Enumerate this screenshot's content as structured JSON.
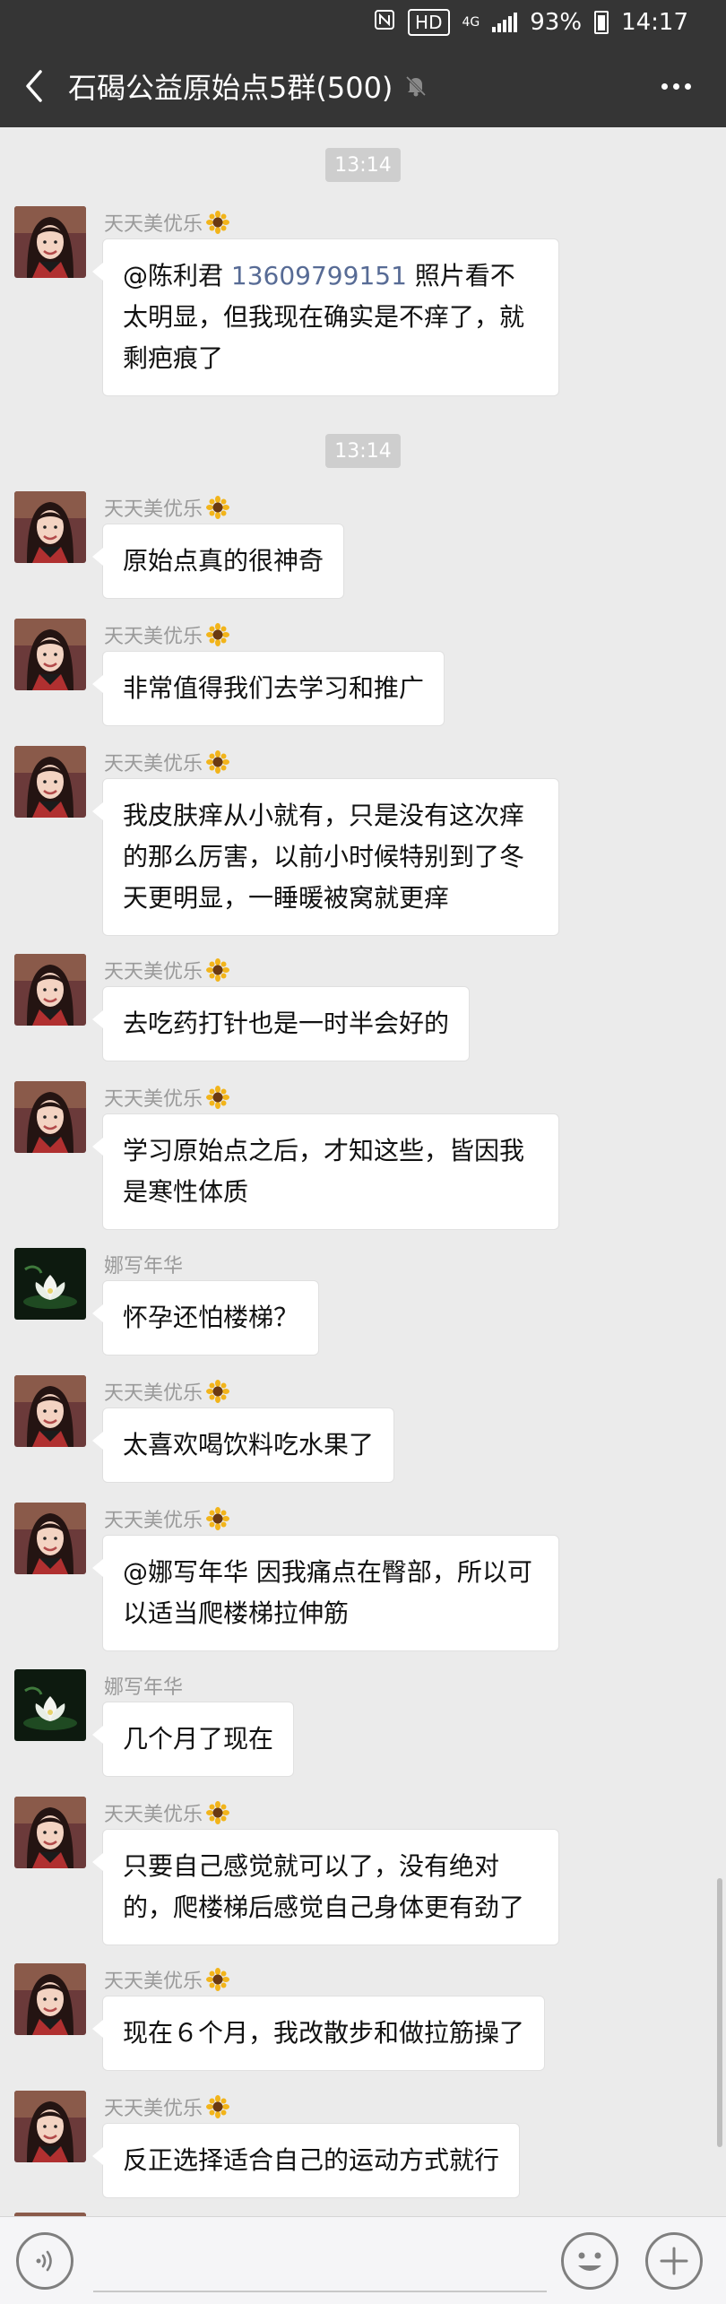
{
  "status_bar": {
    "network": "4G",
    "battery": "93%",
    "time": "14:17",
    "hd": "HD"
  },
  "header": {
    "title": "石碣公益原始点5群(500)"
  },
  "chat": {
    "times": [
      "13:14",
      "13:14"
    ],
    "messages": [
      {
        "sender": "天天美优乐",
        "mention": "@陈利君",
        "phone": "13609799151",
        "text": " 照片看不太明显，但我现在确实是不痒了，就剩疤痕了"
      },
      {
        "sender": "天天美优乐",
        "text": "原始点真的很神奇"
      },
      {
        "sender": "天天美优乐",
        "text": "非常值得我们去学习和推广"
      },
      {
        "sender": "天天美优乐",
        "text": "我皮肤痒从小就有，只是没有这次痒的那么厉害，以前小时候特别到了冬天更明显，一睡暖被窝就更痒"
      },
      {
        "sender": "天天美优乐",
        "text": "去吃药打针也是一时半会好的"
      },
      {
        "sender": "天天美优乐",
        "text": "学习原始点之后，才知这些，皆因我是寒性体质"
      },
      {
        "sender": "娜写年华",
        "text": "怀孕还怕楼梯？"
      },
      {
        "sender": "天天美优乐",
        "text": "太喜欢喝饮料吃水果了"
      },
      {
        "sender": "天天美优乐",
        "text": "@娜写年华  因我痛点在臀部，所以可以适当爬楼梯拉伸筋"
      },
      {
        "sender": "娜写年华",
        "text": "几个月了现在"
      },
      {
        "sender": "天天美优乐",
        "text": "只要自己感觉就可以了，没有绝对的，爬楼梯后感觉自己身体更有劲了"
      },
      {
        "sender": "天天美优乐",
        "text": "现在６个月，我改散步和做拉筋操了"
      },
      {
        "sender": "天天美优乐",
        "text": "反正选择适合自己的运动方式就行"
      }
    ]
  },
  "icons": {
    "back": "back-arrow-icon",
    "mute": "mute-bell-icon",
    "more": "more-dots-icon",
    "voice": "voice-icon",
    "emoji": "emoji-icon",
    "plus": "plus-icon",
    "sunflower": "sunflower-icon"
  },
  "colors": {
    "header_bg": "#353535",
    "chat_bg": "#ebebeb",
    "link": "#576b95",
    "sender": "#9a9a9a"
  }
}
